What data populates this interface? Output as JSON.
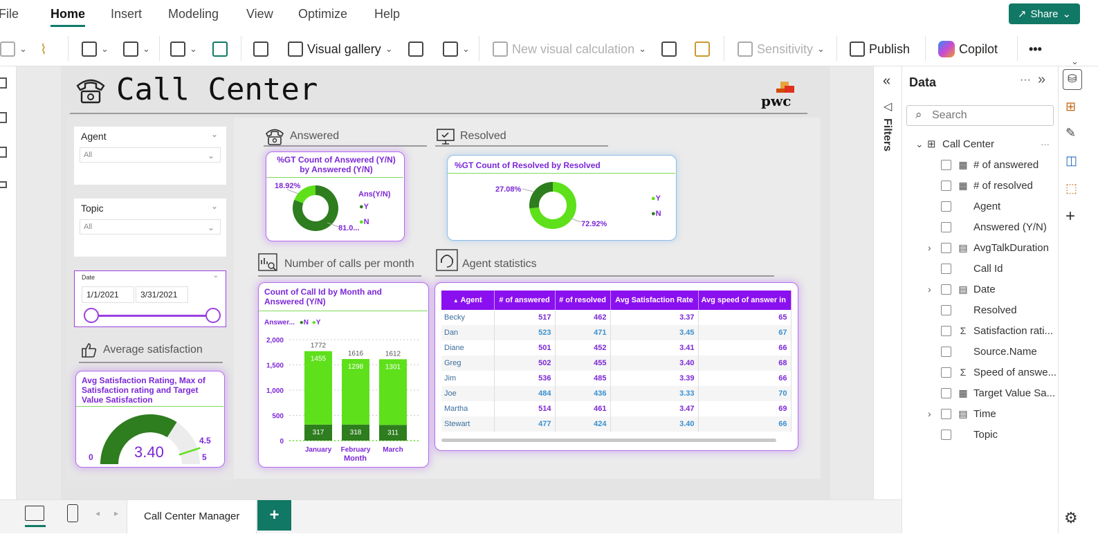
{
  "menu": {
    "items": [
      "File",
      "Home",
      "Insert",
      "Modeling",
      "View",
      "Optimize",
      "Help"
    ],
    "share_label": "Share"
  },
  "ribbon": {
    "visual_gallery": "Visual gallery",
    "new_visual_calculation": "New visual calculation",
    "sensitivity": "Sensitivity",
    "publish": "Publish",
    "copilot": "Copilot",
    "more": "•••"
  },
  "report": {
    "title": "Call Center",
    "logo_text": "pwc",
    "slicers": {
      "agent": {
        "title": "Agent",
        "value": "All"
      },
      "topic": {
        "title": "Topic",
        "value": "All"
      },
      "date": {
        "title": "Date",
        "start": "1/1/2021",
        "end": "3/31/2021"
      }
    },
    "sections": {
      "answered": "Answered",
      "resolved": "Resolved",
      "calls_per_month": "Number of calls per month",
      "agent_statistics": "Agent statistics",
      "avg_satisfaction": "Average satisfaction"
    },
    "answered_donut": {
      "title": "%GT Count of Answered (Y/N) by Answered (Y/N)",
      "legend_title": "Ans(Y/N)",
      "label_n": "18.92%",
      "label_y": "81.0...",
      "legend": [
        "Y",
        "N"
      ]
    },
    "resolved_donut": {
      "title": "%GT Count of Resolved by Resolved",
      "label_n": "27.08%",
      "label_y": "72.92%",
      "legend": [
        "Y",
        "N"
      ]
    },
    "gauge": {
      "title": "Avg Satisfaction Rating, Max of Satisfaction rating and Target Value Satisfaction",
      "value_label": "3.40",
      "min_label": "0",
      "max_label": "5",
      "target_label": "4.5"
    },
    "bar_chart": {
      "title": "Count of Call Id by Month and Answered (Y/N)",
      "legend_title": "Answer...",
      "legend": [
        "N",
        "Y"
      ],
      "xlabel": "Month"
    },
    "table": {
      "headers": [
        "Agent",
        "# of answered",
        "# of resolved",
        "Avg Satisfaction Rate",
        "Avg speed of answer in"
      ],
      "rows": [
        [
          "Becky",
          "517",
          "462",
          "3.37",
          "65"
        ],
        [
          "Dan",
          "523",
          "471",
          "3.45",
          "67"
        ],
        [
          "Diane",
          "501",
          "452",
          "3.41",
          "66"
        ],
        [
          "Greg",
          "502",
          "455",
          "3.40",
          "68"
        ],
        [
          "Jim",
          "536",
          "485",
          "3.39",
          "66"
        ],
        [
          "Joe",
          "484",
          "436",
          "3.33",
          "70"
        ],
        [
          "Martha",
          "514",
          "461",
          "3.47",
          "69"
        ],
        [
          "Stewart",
          "477",
          "424",
          "3.40",
          "66"
        ]
      ]
    }
  },
  "chart_data": [
    {
      "type": "pie",
      "title": "%GT Count of Answered (Y/N) by Answered (Y/N)",
      "categories": [
        "Y",
        "N"
      ],
      "values": [
        81.08,
        18.92
      ],
      "colors": [
        "#2e7d1e",
        "#5ee01a"
      ]
    },
    {
      "type": "pie",
      "title": "%GT Count of Resolved by Resolved",
      "categories": [
        "Y",
        "N"
      ],
      "values": [
        72.92,
        27.08
      ],
      "colors": [
        "#5ee01a",
        "#2e7d1e"
      ]
    },
    {
      "type": "bar",
      "title": "Count of Call Id by Month and Answered (Y/N)",
      "categories": [
        "January",
        "February",
        "March"
      ],
      "series": [
        {
          "name": "N",
          "values": [
            317,
            318,
            311
          ],
          "color": "#2e7d1e"
        },
        {
          "name": "Y",
          "values": [
            1455,
            1298,
            1301
          ],
          "color": "#5ee01a"
        }
      ],
      "totals": [
        1772,
        1616,
        1612
      ],
      "xlabel": "Month",
      "ylabel": "",
      "yticks": [
        "0",
        "500",
        "1,000",
        "1,500",
        "2,000"
      ],
      "ylim": [
        0,
        2000
      ]
    },
    {
      "type": "gauge",
      "title": "Avg Satisfaction Rating, Max of Satisfaction rating and Target Value Satisfaction",
      "value": 3.4,
      "min": 0,
      "max": 5,
      "target": 4.5
    }
  ],
  "filters_label": "Filters",
  "data_pane": {
    "title": "Data",
    "search_placeholder": "Search",
    "table_name": "Call Center",
    "fields": [
      {
        "name": "# of answered",
        "type": "calc-icon",
        "expand": false
      },
      {
        "name": "# of resolved",
        "type": "calc-icon",
        "expand": false
      },
      {
        "name": "Agent",
        "type": "",
        "expand": false
      },
      {
        "name": "Answered (Y/N)",
        "type": "",
        "expand": false
      },
      {
        "name": "AvgTalkDuration",
        "type": "calendar-icon",
        "expand": true
      },
      {
        "name": "Call Id",
        "type": "",
        "expand": false
      },
      {
        "name": "Date",
        "type": "calendar-icon",
        "expand": true
      },
      {
        "name": "Resolved",
        "type": "",
        "expand": false
      },
      {
        "name": "Satisfaction rati...",
        "type": "sigma-icon",
        "expand": false
      },
      {
        "name": "Source.Name",
        "type": "",
        "expand": false
      },
      {
        "name": "Speed of answe...",
        "type": "sigma-icon",
        "expand": false
      },
      {
        "name": "Target Value Sa...",
        "type": "calc-icon",
        "expand": false
      },
      {
        "name": "Time",
        "type": "calendar-icon",
        "expand": true
      },
      {
        "name": "Topic",
        "type": "",
        "expand": false
      }
    ]
  },
  "bottom": {
    "page_tab": "Call Center Manager",
    "add_label": "+"
  }
}
